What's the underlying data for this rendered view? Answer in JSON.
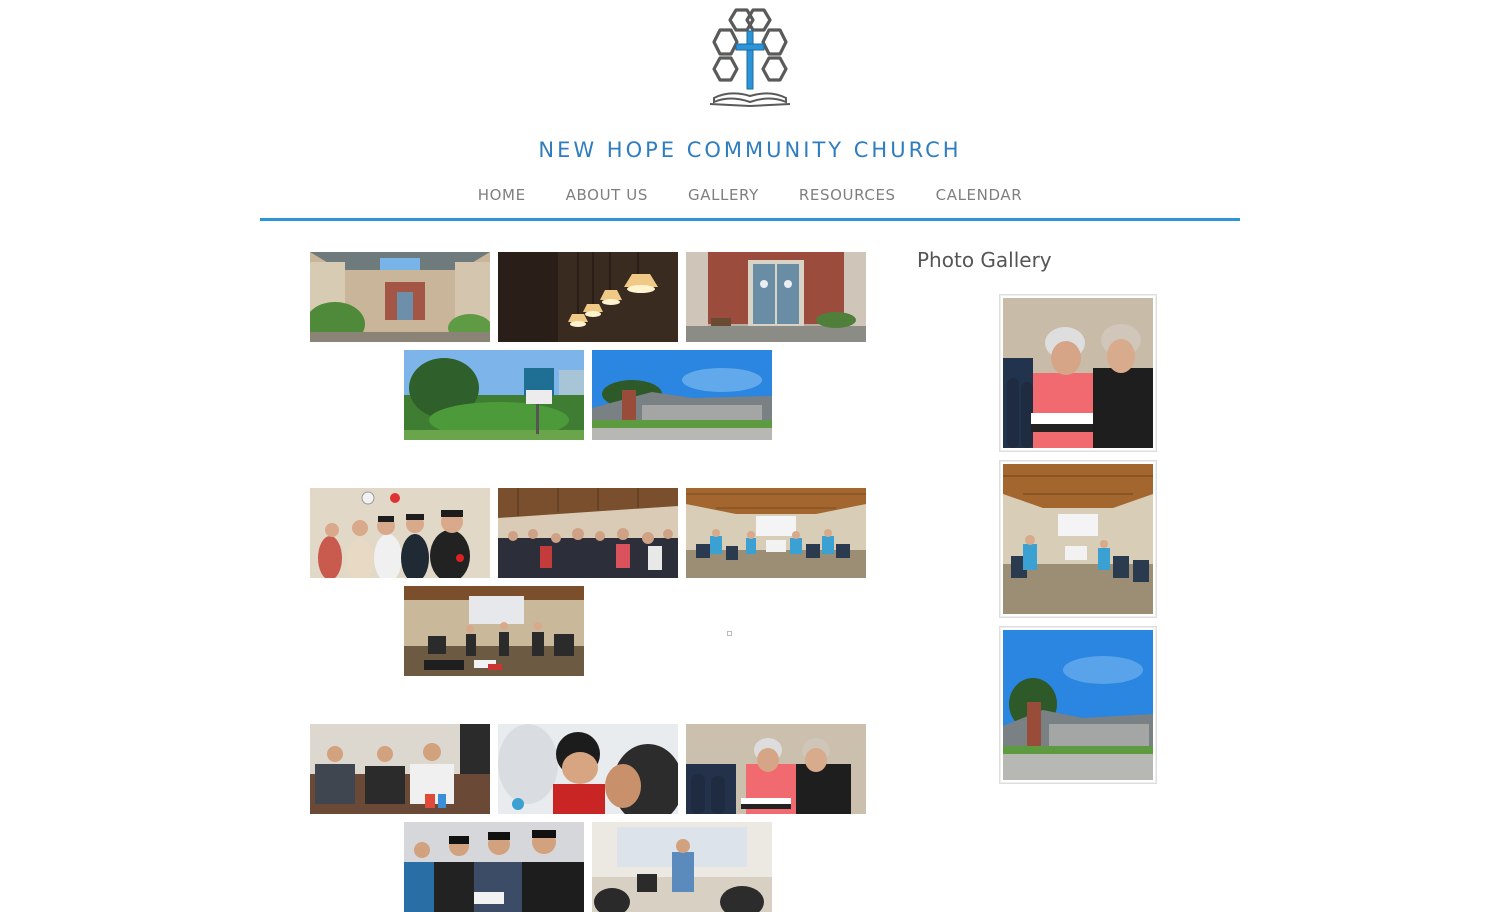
{
  "site": {
    "title": "NEW HOPE COMMUNITY CHURCH",
    "logo_icon": "hexagon-cross-bible-icon",
    "accent_color": "#2b95d8"
  },
  "nav": {
    "items": [
      {
        "label": "HOME"
      },
      {
        "label": "ABOUT US"
      },
      {
        "label": "GALLERY"
      },
      {
        "label": "RESOURCES"
      },
      {
        "label": "CALENDAR"
      }
    ]
  },
  "gallery": {
    "groups": [
      {
        "photos": [
          "church-courtyard",
          "pendant-lights",
          "church-entrance-doors",
          "church-sign",
          "church-building-exterior"
        ]
      },
      {
        "photos": [
          "congregation-front-row",
          "congregation-standing",
          "worship-hall-wide",
          "worship-band-stage"
        ]
      },
      {
        "photos": [
          "men-on-sofa",
          "child-with-father",
          "women-reading-bible",
          "men-reading-bible",
          "speaker-at-podium"
        ]
      }
    ]
  },
  "sidebar": {
    "title": "Photo Gallery",
    "photos": [
      "women-reading-bible",
      "worship-hall-wide",
      "church-building-exterior"
    ]
  }
}
